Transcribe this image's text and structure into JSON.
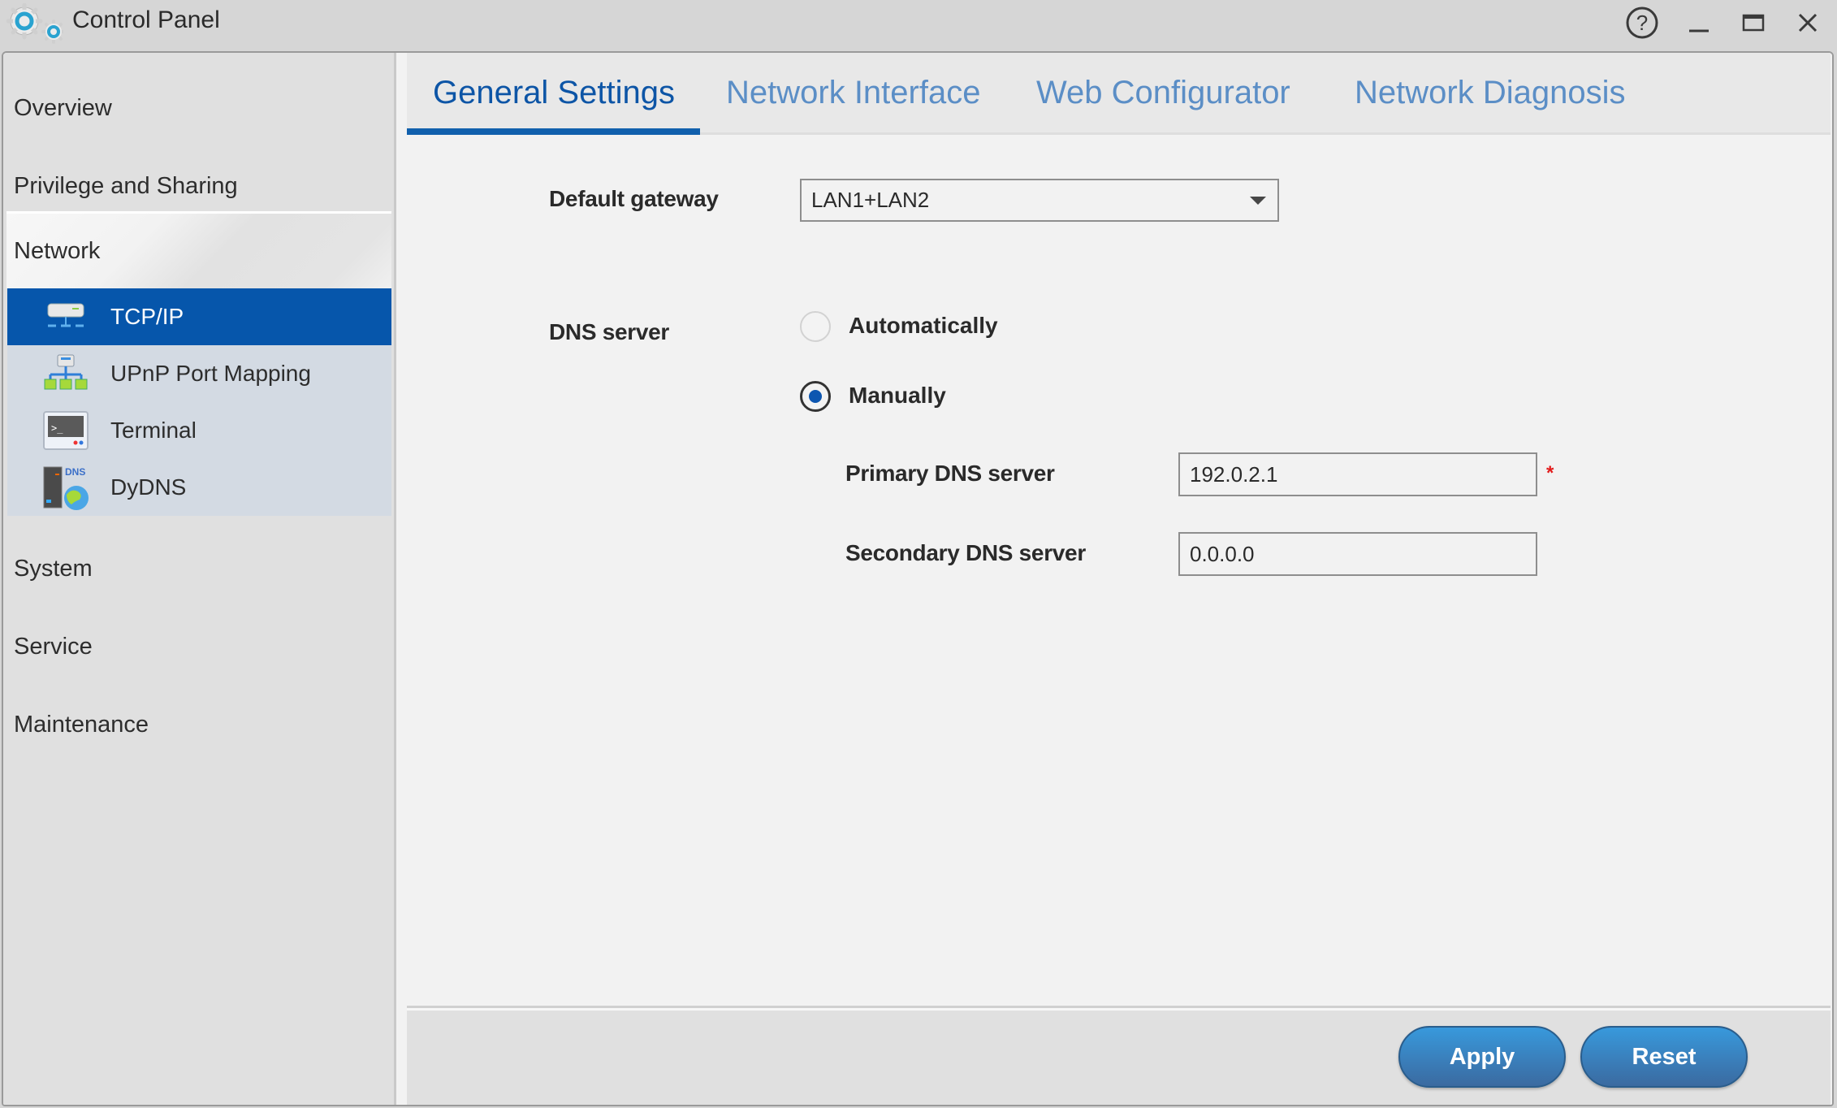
{
  "window": {
    "title": "Control Panel",
    "controls": [
      "help-icon",
      "minimize-icon",
      "maximize-icon",
      "close-icon"
    ]
  },
  "sidebar": {
    "items": [
      {
        "label": "Overview"
      },
      {
        "label": "Privilege and Sharing"
      },
      {
        "label": "Network",
        "expanded": true,
        "children": [
          {
            "label": "TCP/IP",
            "icon": "network-device-icon",
            "active": true
          },
          {
            "label": "UPnP Port Mapping",
            "icon": "network-topology-icon"
          },
          {
            "label": "Terminal",
            "icon": "terminal-icon"
          },
          {
            "label": "DyDNS",
            "icon": "dns-server-globe-icon"
          }
        ]
      },
      {
        "label": "System"
      },
      {
        "label": "Service"
      },
      {
        "label": "Maintenance"
      }
    ]
  },
  "tabs": [
    {
      "label": "General Settings",
      "active": true
    },
    {
      "label": "Network Interface"
    },
    {
      "label": "Web Configurator"
    },
    {
      "label": "Network Diagnosis"
    }
  ],
  "form": {
    "default_gateway": {
      "label": "Default gateway",
      "value": "LAN1+LAN2"
    },
    "dns_server": {
      "label": "DNS server",
      "options": [
        {
          "label": "Automatically",
          "selected": false
        },
        {
          "label": "Manually",
          "selected": true
        }
      ],
      "primary": {
        "label": "Primary DNS server",
        "value": "192.0.2.1",
        "required_mark": "*"
      },
      "secondary": {
        "label": "Secondary DNS server",
        "value": "0.0.0.0"
      }
    }
  },
  "footer": {
    "apply_label": "Apply",
    "reset_label": "Reset"
  },
  "colors": {
    "accent": "#0656ab",
    "tab_active": "#0d55a6",
    "tab_inactive": "#5b8ec6",
    "button": "#3899dc",
    "required": "#e31b1b"
  }
}
